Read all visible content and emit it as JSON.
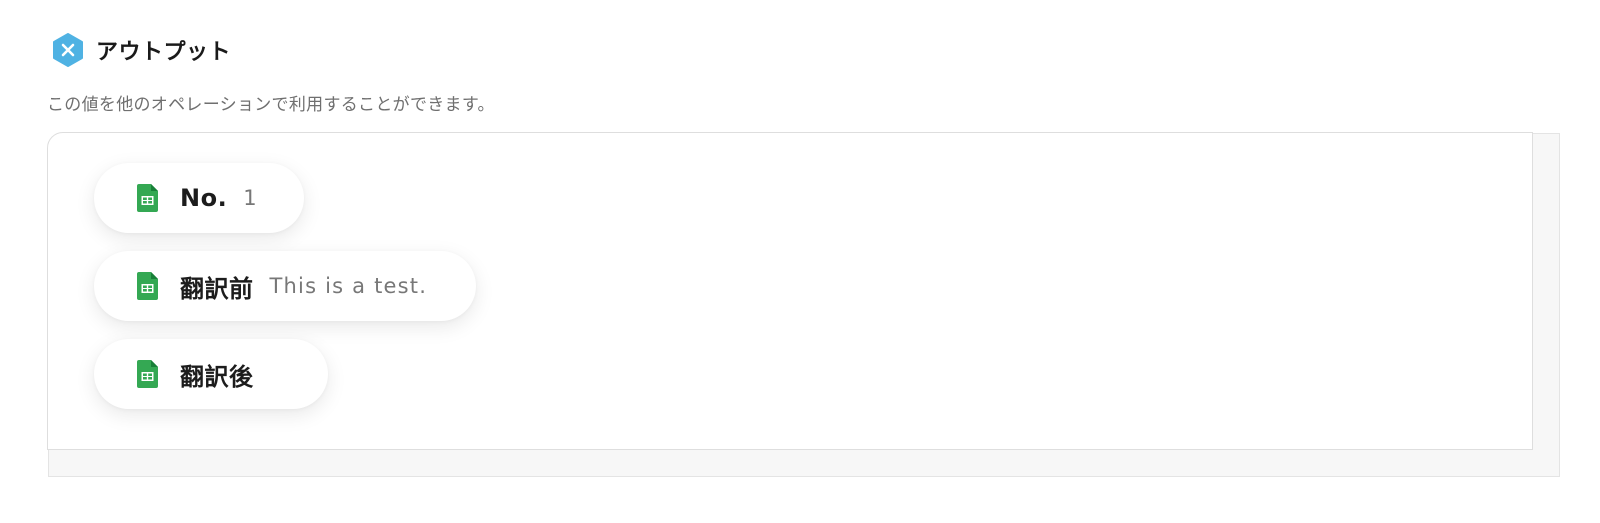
{
  "header": {
    "title": "アウトプット",
    "logo_icon": "hexagon-x-logo-icon",
    "logo_color": "#4fb2e3"
  },
  "subtitle": "この値を他のオペレーションで利用することができます。",
  "outputs": [
    {
      "icon": "google-sheets-icon",
      "label": "No.",
      "value": "1"
    },
    {
      "icon": "google-sheets-icon",
      "label": "翻訳前",
      "value": "This is a test."
    },
    {
      "icon": "google-sheets-icon",
      "label": "翻訳後",
      "value": ""
    }
  ],
  "colors": {
    "sheets_green": "#34a853",
    "sheets_fold": "#188038",
    "panel_border": "#dedede"
  }
}
